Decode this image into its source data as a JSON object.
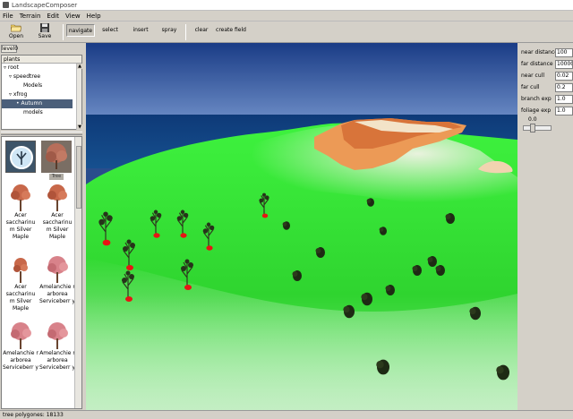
{
  "window": {
    "title": "LandscapeComposer"
  },
  "menu": [
    "File",
    "Terrain",
    "Edit",
    "View",
    "Help"
  ],
  "toolbar": {
    "open_label": "Open",
    "save_label": "Save",
    "tools": [
      "navigate",
      "select",
      "insert",
      "spray",
      "clear",
      "create field"
    ],
    "active_tool": "navigate"
  },
  "left": {
    "level_tab": "level0",
    "tree_header": "plants",
    "tree": [
      "root",
      "speedtree",
      "Models",
      "xfrog",
      "Autumn",
      "models"
    ],
    "plants": [
      {
        "label": ""
      },
      {
        "label": "Tree"
      },
      {
        "label": "Acer saccharinu m Silver Maple"
      },
      {
        "label": "Acer saccharinu m Silver Maple"
      },
      {
        "label": "Acer saccharinu m Silver Maple"
      },
      {
        "label": "Amelanchie r arborea Serviceberr y"
      },
      {
        "label": "Amelanchie r arborea Serviceberr y"
      },
      {
        "label": "Amelanchie r arborea Serviceberr y"
      }
    ]
  },
  "params": [
    {
      "label": "near distance",
      "value": "100"
    },
    {
      "label": "far distance",
      "value": "10000"
    },
    {
      "label": "near cull",
      "value": "0.02"
    },
    {
      "label": "far cull",
      "value": "0.2"
    },
    {
      "label": "branch exp",
      "value": "1.0"
    },
    {
      "label": "foliage exp",
      "value": "1.0"
    }
  ],
  "slider": {
    "value": "0.0"
  },
  "status": {
    "text": "tree polygones: 18133"
  },
  "colors": {
    "sky": "#2a4d8c",
    "grass": "#33e833",
    "mountain": "#e8894a",
    "marker": "#e81414"
  }
}
